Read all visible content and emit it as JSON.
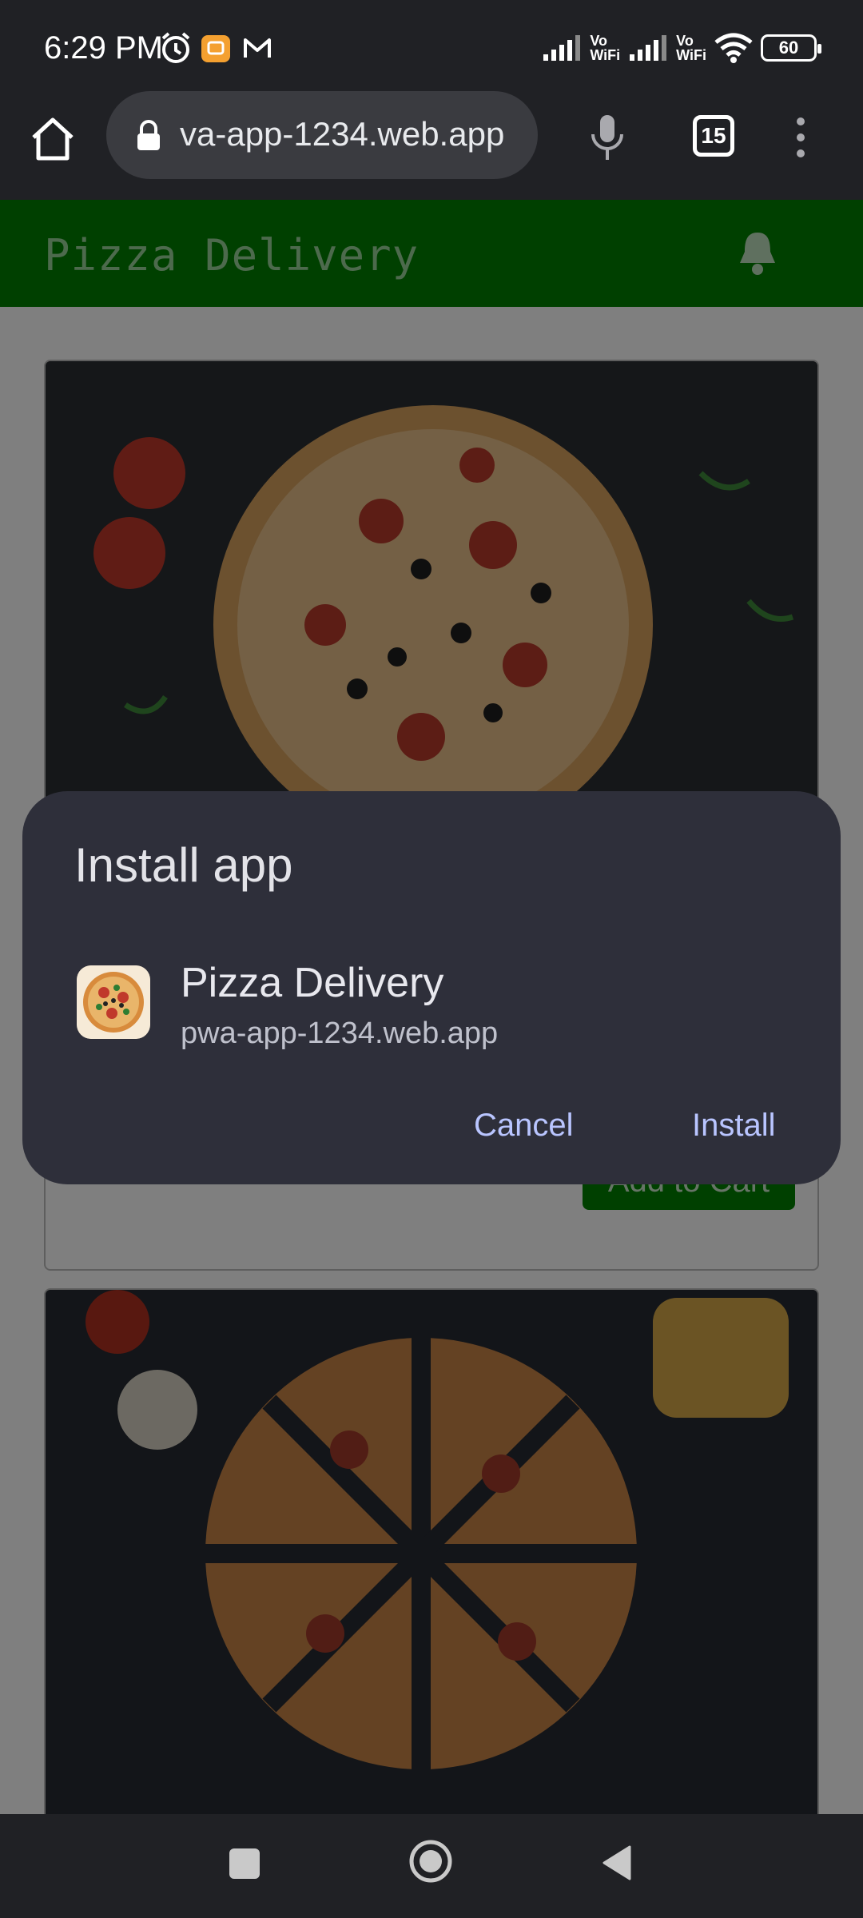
{
  "status_bar": {
    "time": "6:29 PM",
    "network_1": "Vo\nWiFi",
    "network_2": "Vo\nWiFi",
    "battery": "60",
    "icons": [
      "alarm-icon",
      "app-notification-icon",
      "gmail-icon",
      "signal-icon",
      "wifi-icon",
      "battery-icon"
    ]
  },
  "browser": {
    "url": "va-app-1234.web.app",
    "tab_count": "15",
    "icons": [
      "home-icon",
      "lock-icon",
      "mic-icon",
      "tabs-icon",
      "overflow-menu-icon"
    ]
  },
  "web_app": {
    "title": "Pizza Delivery",
    "add_to_cart_label": "Add to Cart",
    "colors": {
      "primary": "#008000"
    }
  },
  "install_dialog": {
    "title": "Install app",
    "app_name": "Pizza Delivery",
    "app_url": "pwa-app-1234.web.app",
    "cancel_label": "Cancel",
    "install_label": "Install",
    "colors": {
      "background": "#2e2f3a",
      "accent": "#b9c5ff"
    }
  },
  "nav_bar": {
    "icons": [
      "recent-apps-icon",
      "home-circle-icon",
      "back-icon"
    ]
  }
}
